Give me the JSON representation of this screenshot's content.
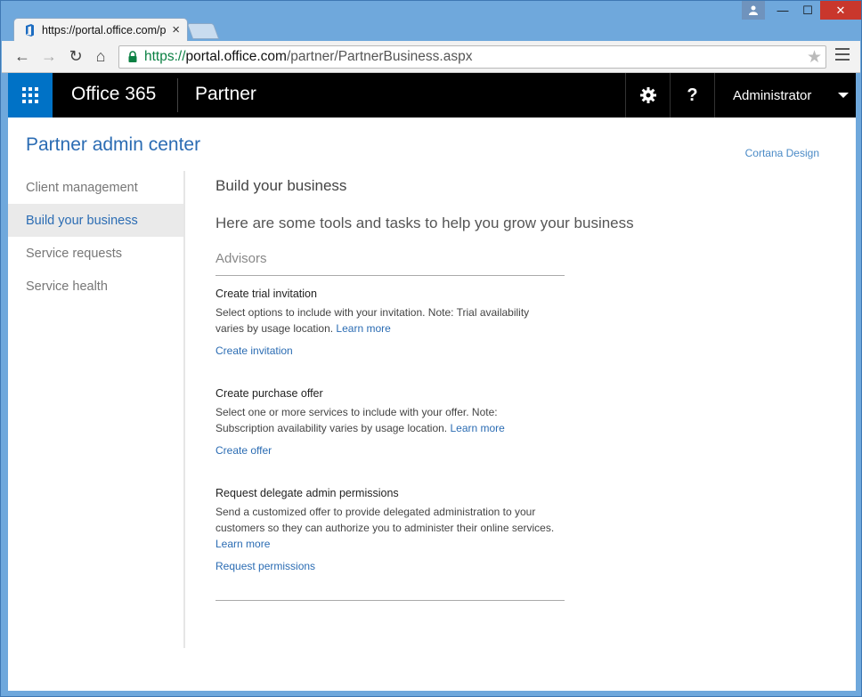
{
  "browser": {
    "tab_title": "https://portal.office.com/p",
    "url_scheme": "https://",
    "url_host": "portal.office.com",
    "url_path": "/partner/PartnerBusiness.aspx",
    "close_glyph": "×",
    "star_glyph": "★",
    "back_glyph": "←",
    "forward_glyph": "→",
    "reload_glyph": "↻",
    "home_glyph": "⌂",
    "window_controls": {
      "minimize": "—",
      "maximize": "☐",
      "close": "✕"
    }
  },
  "o365": {
    "brand": "Office 365",
    "app": "Partner",
    "help_glyph": "?",
    "user": "Administrator"
  },
  "header": {
    "title": "Partner admin center",
    "top_link": "Cortana Design"
  },
  "nav": {
    "items": [
      {
        "label": "Client management",
        "active": false
      },
      {
        "label": "Build your business",
        "active": true
      },
      {
        "label": "Service requests",
        "active": false
      },
      {
        "label": "Service health",
        "active": false
      }
    ]
  },
  "main": {
    "section_title": "Build your business",
    "tagline": "Here are some tools and tasks to help you grow your business",
    "advisors_label": "Advisors",
    "cards": [
      {
        "title": "Create trial invitation",
        "desc": "Select options to include with your invitation. Note: Trial availability varies by usage location.",
        "learn_more": "Learn more",
        "action": "Create invitation"
      },
      {
        "title": "Create purchase offer",
        "desc": "Select one or more services to include with your offer. Note: Subscription availability varies by usage location.",
        "learn_more": "Learn more",
        "action": "Create offer"
      },
      {
        "title": "Request delegate admin permissions",
        "desc": "Send a customized offer to provide delegated administration to your customers so they can authorize you to administer their online services.",
        "learn_more": "Learn more",
        "action": "Request permissions"
      }
    ]
  },
  "colors": {
    "accent": "#0072c6",
    "link": "#2b6cb3",
    "header_bg": "#000000"
  }
}
